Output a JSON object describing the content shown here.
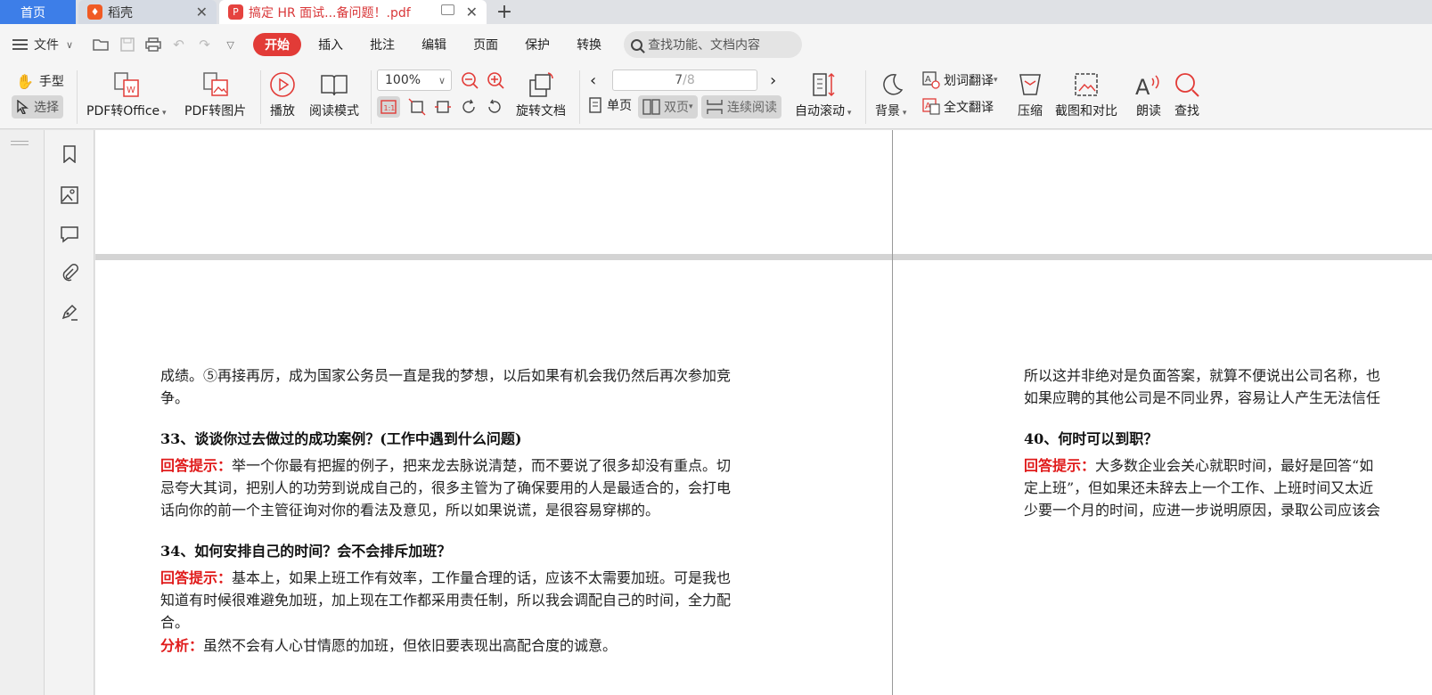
{
  "tabs": {
    "home": "首页",
    "daoke": "稻壳",
    "pdf": "搞定 HR 面试...备问题！.pdf",
    "add": "+"
  },
  "menu": {
    "file": "文件",
    "tabs": [
      "开始",
      "插入",
      "批注",
      "编辑",
      "页面",
      "保护",
      "转换"
    ],
    "search_placeholder": "查找功能、文档内容"
  },
  "ribbon": {
    "hand": "手型",
    "select": "选择",
    "pdf_to_office": "PDF转Office",
    "pdf_to_image": "PDF转图片",
    "play": "播放",
    "read_mode": "阅读模式",
    "zoom": "100%",
    "rotate": "旋转文档",
    "page_current": "7",
    "page_total": "/8",
    "single": "单页",
    "double": "双页",
    "continuous": "连续阅读",
    "auto_scroll": "自动滚动",
    "background": "背景",
    "word_translate": "划词翻译",
    "full_translate": "全文翻译",
    "compress": "压缩",
    "screenshot": "截图和对比",
    "read_aloud": "朗读",
    "find": "查找"
  },
  "colors": {
    "accent": "#e23b37",
    "home_tab": "#3d7ee8",
    "answer_red": "#e01b1b"
  },
  "doc": {
    "left": {
      "l1": "成绩。⑤再接再厉，成为国家公务员一直是我的梦想，以后如果有机会我仍然后再次参加竞",
      "l2": "争。",
      "q33": "33、谈谈你过去做过的成功案例？(工作中遇到什么问题)",
      "hint_label": "回答提示：",
      "a33_1": "举一个你最有把握的例子，把来龙去脉说清楚，而不要说了很多却没有重点。切",
      "a33_2": "忌夸大其词，把别人的功劳到说成自己的，很多主管为了确保要用的人是最适合的，会打电",
      "a33_3": "话向你的前一个主管征询对你的看法及意见，所以如果说谎，是很容易穿梆的。",
      "q34": "34、如何安排自己的时间？会不会排斥加班？",
      "a34_1": "基本上，如果上班工作有效率，工作量合理的话，应该不太需要加班。可是我也",
      "a34_2": "知道有时候很难避免加班，加上现在工作都采用责任制，所以我会调配自己的时间，全力配",
      "a34_3": "合。",
      "analysis_label": "分析：",
      "analysis": "虽然不会有人心甘情愿的加班，但依旧要表现出高配合度的诚意。"
    },
    "right": {
      "l1": "所以这并非绝对是负面答案，就算不便说出公司名称，也",
      "l2": "如果应聘的其他公司是不同业界，容易让人产生无法信任",
      "q40": "40、何时可以到职？",
      "hint_label": "回答提示：",
      "a40_1": "大多数企业会关心就职时间，最好是回答“如",
      "a40_2": "定上班”，但如果还未辞去上一个工作、上班时间又太近",
      "a40_3": "少要一个月的时间，应进一步说明原因，录取公司应该会"
    }
  }
}
